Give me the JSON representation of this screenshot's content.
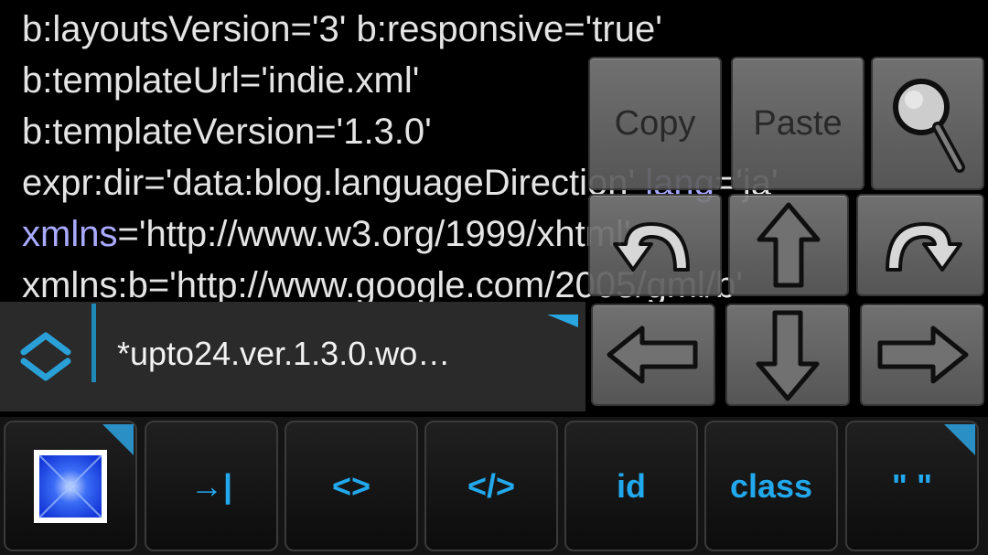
{
  "editor": {
    "lines": [
      [
        {
          "t": "b:layoutsVersion='3' b:responsive='true'"
        }
      ],
      [
        {
          "t": "b:templateUrl='indie.xml'"
        }
      ],
      [
        {
          "t": "b:templateVersion='1.3.0'"
        }
      ],
      [
        {
          "t": "expr:dir='data:blog.languageDirection' "
        },
        {
          "t": "lang",
          "hl": true
        },
        {
          "t": "='ja'"
        }
      ],
      [
        {
          "t": "xmlns",
          "hl": true
        },
        {
          "t": "='http://www.w3.org/1999/xhtml'"
        }
      ],
      [
        {
          "t": "xmlns:b='http://www.google.com/2005/gml/b'"
        }
      ]
    ]
  },
  "panel": {
    "copy_label": "Copy",
    "paste_label": "Paste",
    "search_icon": "magnifier-icon",
    "undo_icon": "undo-arrow-icon",
    "redo_icon": "redo-arrow-icon",
    "up_icon": "arrow-up-icon",
    "down_icon": "arrow-down-icon",
    "left_icon": "arrow-left-icon",
    "right_icon": "arrow-right-icon"
  },
  "filebar": {
    "filename": "*upto24.ver.1.3.0.wo…",
    "toggle_icon": "expand-collapse-icon"
  },
  "keys": [
    {
      "name": "key-image",
      "label": "",
      "icon": "image-tile-icon"
    },
    {
      "name": "key-tab",
      "label": "→|"
    },
    {
      "name": "key-tag",
      "label": "<>"
    },
    {
      "name": "key-close-tag",
      "label": "</>"
    },
    {
      "name": "key-id",
      "label": "id"
    },
    {
      "name": "key-class",
      "label": "class"
    },
    {
      "name": "key-quotes",
      "label": "\" \""
    }
  ],
  "colors": {
    "accent": "#22a8ec",
    "highlight": "#a9a9ff",
    "text": "#e4e4e4",
    "background": "#000000"
  }
}
